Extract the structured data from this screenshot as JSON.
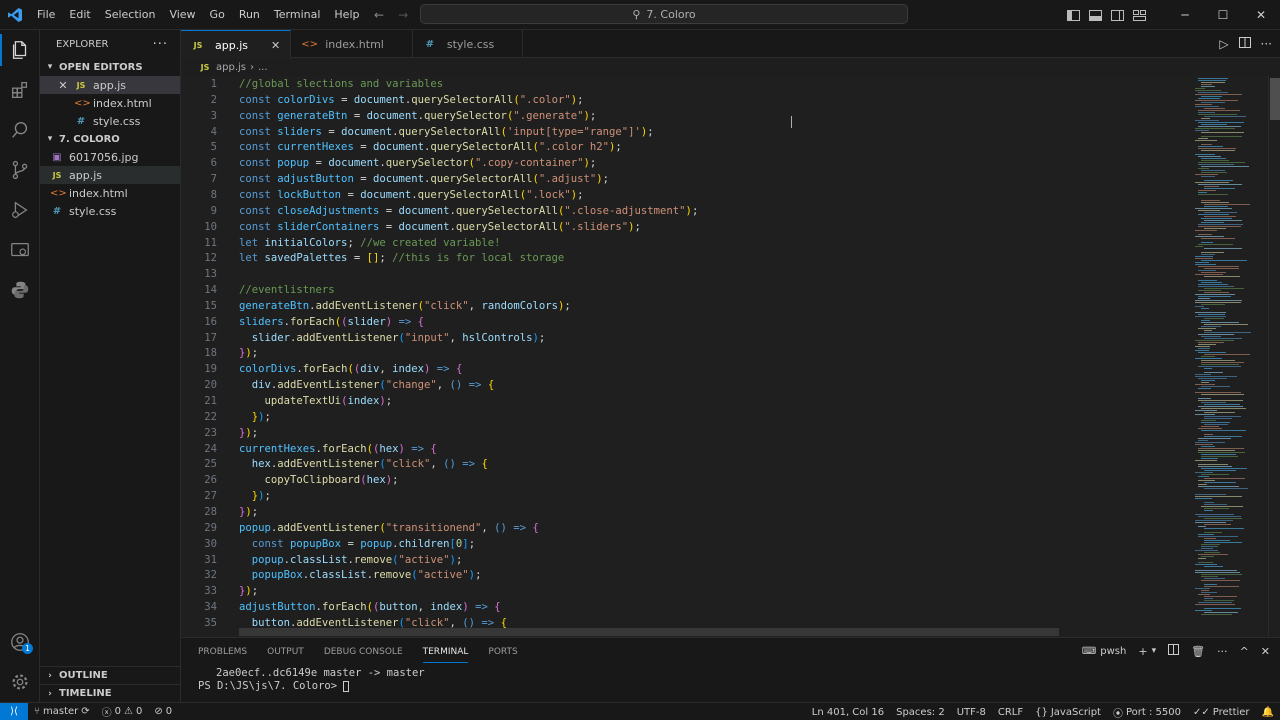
{
  "menu": [
    "File",
    "Edit",
    "Selection",
    "View",
    "Go",
    "Run",
    "Terminal",
    "Help"
  ],
  "command_center": "7. Coloro",
  "explorer": {
    "title": "EXPLORER",
    "open_editors_label": "OPEN EDITORS",
    "open_editors": [
      {
        "name": "app.js",
        "type": "js"
      },
      {
        "name": "index.html",
        "type": "html"
      },
      {
        "name": "style.css",
        "type": "css"
      }
    ],
    "folder_label": "7. COLORO",
    "files": [
      {
        "name": "6017056.jpg",
        "type": "img"
      },
      {
        "name": "app.js",
        "type": "js"
      },
      {
        "name": "index.html",
        "type": "html"
      },
      {
        "name": "style.css",
        "type": "css"
      }
    ],
    "outline_label": "OUTLINE",
    "timeline_label": "TIMELINE"
  },
  "tabs": [
    {
      "name": "app.js",
      "type": "js"
    },
    {
      "name": "index.html",
      "type": "html"
    },
    {
      "name": "style.css",
      "type": "css"
    }
  ],
  "breadcrumb": {
    "file": "app.js",
    "more": "..."
  },
  "code_lines": [
    [
      [
        "//global slections and variables",
        "cm"
      ]
    ],
    [
      [
        "const ",
        "kw"
      ],
      [
        "colorDivs",
        "var"
      ],
      [
        " = ",
        "p"
      ],
      [
        "document",
        "id"
      ],
      [
        ".",
        "p"
      ],
      [
        "querySelectorAll",
        "fn"
      ],
      [
        "(",
        "br"
      ],
      [
        "\".color\"",
        "str"
      ],
      [
        ")",
        "br"
      ],
      [
        ";",
        "p"
      ]
    ],
    [
      [
        "const ",
        "kw"
      ],
      [
        "generateBtn",
        "var"
      ],
      [
        " = ",
        "p"
      ],
      [
        "document",
        "id"
      ],
      [
        ".",
        "p"
      ],
      [
        "querySelector",
        "fn"
      ],
      [
        "(",
        "br"
      ],
      [
        "\".generate\"",
        "str"
      ],
      [
        ")",
        "br"
      ],
      [
        ";",
        "p"
      ]
    ],
    [
      [
        "const ",
        "kw"
      ],
      [
        "sliders",
        "var"
      ],
      [
        " = ",
        "p"
      ],
      [
        "document",
        "id"
      ],
      [
        ".",
        "p"
      ],
      [
        "querySelectorAll",
        "fn"
      ],
      [
        "(",
        "br"
      ],
      [
        "'input[type=\"range\"]'",
        "str"
      ],
      [
        ")",
        "br"
      ],
      [
        ";",
        "p"
      ]
    ],
    [
      [
        "const ",
        "kw"
      ],
      [
        "currentHexes",
        "var"
      ],
      [
        " = ",
        "p"
      ],
      [
        "document",
        "id"
      ],
      [
        ".",
        "p"
      ],
      [
        "querySelectorAll",
        "fn"
      ],
      [
        "(",
        "br"
      ],
      [
        "\".color h2\"",
        "str"
      ],
      [
        ")",
        "br"
      ],
      [
        ";",
        "p"
      ]
    ],
    [
      [
        "const ",
        "kw"
      ],
      [
        "popup",
        "var"
      ],
      [
        " = ",
        "p"
      ],
      [
        "document",
        "id"
      ],
      [
        ".",
        "p"
      ],
      [
        "querySelector",
        "fn"
      ],
      [
        "(",
        "br"
      ],
      [
        "\".copy-container\"",
        "str"
      ],
      [
        ")",
        "br"
      ],
      [
        ";",
        "p"
      ]
    ],
    [
      [
        "const ",
        "kw"
      ],
      [
        "adjustButton",
        "var"
      ],
      [
        " = ",
        "p"
      ],
      [
        "document",
        "id"
      ],
      [
        ".",
        "p"
      ],
      [
        "querySelectorAll",
        "fn"
      ],
      [
        "(",
        "br"
      ],
      [
        "\".adjust\"",
        "str"
      ],
      [
        ")",
        "br"
      ],
      [
        ";",
        "p"
      ]
    ],
    [
      [
        "const ",
        "kw"
      ],
      [
        "lockButton",
        "var"
      ],
      [
        " = ",
        "p"
      ],
      [
        "document",
        "id"
      ],
      [
        ".",
        "p"
      ],
      [
        "querySelectorAll",
        "fn"
      ],
      [
        "(",
        "br"
      ],
      [
        "\".lock\"",
        "str"
      ],
      [
        ")",
        "br"
      ],
      [
        ";",
        "p"
      ]
    ],
    [
      [
        "const ",
        "kw"
      ],
      [
        "closeAdjustments",
        "var"
      ],
      [
        " = ",
        "p"
      ],
      [
        "document",
        "id"
      ],
      [
        ".",
        "p"
      ],
      [
        "querySelectorAll",
        "fn"
      ],
      [
        "(",
        "br"
      ],
      [
        "\".close-adjustment\"",
        "str"
      ],
      [
        ")",
        "br"
      ],
      [
        ";",
        "p"
      ]
    ],
    [
      [
        "const ",
        "kw"
      ],
      [
        "sliderContainers",
        "var"
      ],
      [
        " = ",
        "p"
      ],
      [
        "document",
        "id"
      ],
      [
        ".",
        "p"
      ],
      [
        "querySelectorAll",
        "fn"
      ],
      [
        "(",
        "br"
      ],
      [
        "\".sliders\"",
        "str"
      ],
      [
        ")",
        "br"
      ],
      [
        ";",
        "p"
      ]
    ],
    [
      [
        "let ",
        "kw"
      ],
      [
        "initialColors",
        "id"
      ],
      [
        "; ",
        "p"
      ],
      [
        "//we created variable!",
        "cm"
      ]
    ],
    [
      [
        "let ",
        "kw"
      ],
      [
        "savedPalettes",
        "id"
      ],
      [
        " = ",
        "p"
      ],
      [
        "[]",
        "br"
      ],
      [
        "; ",
        "p"
      ],
      [
        "//this is for local storage",
        "cm"
      ]
    ],
    [],
    [
      [
        "//eventlistners",
        "cm"
      ]
    ],
    [
      [
        "generateBtn",
        "var"
      ],
      [
        ".",
        "p"
      ],
      [
        "addEventListener",
        "fn"
      ],
      [
        "(",
        "br"
      ],
      [
        "\"click\"",
        "str"
      ],
      [
        ", ",
        "p"
      ],
      [
        "randomColors",
        "id"
      ],
      [
        ")",
        "br"
      ],
      [
        ";",
        "p"
      ]
    ],
    [
      [
        "sliders",
        "var"
      ],
      [
        ".",
        "p"
      ],
      [
        "forEach",
        "fn"
      ],
      [
        "(",
        "br"
      ],
      [
        "(",
        "br2"
      ],
      [
        "slider",
        "id"
      ],
      [
        ")",
        "br2"
      ],
      [
        " => ",
        "kw"
      ],
      [
        "{",
        "br2"
      ]
    ],
    [
      [
        "  slider",
        "id"
      ],
      [
        ".",
        "p"
      ],
      [
        "addEventListener",
        "fn"
      ],
      [
        "(",
        "br3"
      ],
      [
        "\"input\"",
        "str"
      ],
      [
        ", ",
        "p"
      ],
      [
        "hslControls",
        "id"
      ],
      [
        ")",
        "br3"
      ],
      [
        ";",
        "p"
      ]
    ],
    [
      [
        "}",
        "br2"
      ],
      [
        ")",
        "br"
      ],
      [
        ";",
        "p"
      ]
    ],
    [
      [
        "colorDivs",
        "var"
      ],
      [
        ".",
        "p"
      ],
      [
        "forEach",
        "fn"
      ],
      [
        "(",
        "br"
      ],
      [
        "(",
        "br2"
      ],
      [
        "div",
        "id"
      ],
      [
        ", ",
        "p"
      ],
      [
        "index",
        "id"
      ],
      [
        ")",
        "br2"
      ],
      [
        " => ",
        "kw"
      ],
      [
        "{",
        "br2"
      ]
    ],
    [
      [
        "  div",
        "id"
      ],
      [
        ".",
        "p"
      ],
      [
        "addEventListener",
        "fn"
      ],
      [
        "(",
        "br3"
      ],
      [
        "\"change\"",
        "str"
      ],
      [
        ", ",
        "p"
      ],
      [
        "() => ",
        "kw"
      ],
      [
        "{",
        "br"
      ]
    ],
    [
      [
        "    updateTextUi",
        "fn"
      ],
      [
        "(",
        "br2"
      ],
      [
        "index",
        "id"
      ],
      [
        ")",
        "br2"
      ],
      [
        ";",
        "p"
      ]
    ],
    [
      [
        "  }",
        "br"
      ],
      [
        ")",
        "br3"
      ],
      [
        ";",
        "p"
      ]
    ],
    [
      [
        "}",
        "br2"
      ],
      [
        ")",
        "br"
      ],
      [
        ";",
        "p"
      ]
    ],
    [
      [
        "currentHexes",
        "var"
      ],
      [
        ".",
        "p"
      ],
      [
        "forEach",
        "fn"
      ],
      [
        "(",
        "br"
      ],
      [
        "(",
        "br2"
      ],
      [
        "hex",
        "id"
      ],
      [
        ")",
        "br2"
      ],
      [
        " => ",
        "kw"
      ],
      [
        "{",
        "br2"
      ]
    ],
    [
      [
        "  hex",
        "id"
      ],
      [
        ".",
        "p"
      ],
      [
        "addEventListener",
        "fn"
      ],
      [
        "(",
        "br3"
      ],
      [
        "\"click\"",
        "str"
      ],
      [
        ", ",
        "p"
      ],
      [
        "() => ",
        "kw"
      ],
      [
        "{",
        "br"
      ]
    ],
    [
      [
        "    copyToClipboard",
        "fn"
      ],
      [
        "(",
        "br2"
      ],
      [
        "hex",
        "id"
      ],
      [
        ")",
        "br2"
      ],
      [
        ";",
        "p"
      ]
    ],
    [
      [
        "  }",
        "br"
      ],
      [
        ")",
        "br3"
      ],
      [
        ";",
        "p"
      ]
    ],
    [
      [
        "}",
        "br2"
      ],
      [
        ")",
        "br"
      ],
      [
        ";",
        "p"
      ]
    ],
    [
      [
        "popup",
        "var"
      ],
      [
        ".",
        "p"
      ],
      [
        "addEventListener",
        "fn"
      ],
      [
        "(",
        "br"
      ],
      [
        "\"transitionend\"",
        "str"
      ],
      [
        ", ",
        "p"
      ],
      [
        "() => ",
        "kw"
      ],
      [
        "{",
        "br2"
      ]
    ],
    [
      [
        "  const ",
        "kw"
      ],
      [
        "popupBox",
        "var"
      ],
      [
        " = ",
        "p"
      ],
      [
        "popup",
        "var"
      ],
      [
        ".",
        "p"
      ],
      [
        "children",
        "id"
      ],
      [
        "[",
        "br3"
      ],
      [
        "0",
        "num"
      ],
      [
        "]",
        "br3"
      ],
      [
        ";",
        "p"
      ]
    ],
    [
      [
        "  popup",
        "var"
      ],
      [
        ".",
        "p"
      ],
      [
        "classList",
        "id"
      ],
      [
        ".",
        "p"
      ],
      [
        "remove",
        "fn"
      ],
      [
        "(",
        "br3"
      ],
      [
        "\"active\"",
        "str"
      ],
      [
        ")",
        "br3"
      ],
      [
        ";",
        "p"
      ]
    ],
    [
      [
        "  popupBox",
        "var"
      ],
      [
        ".",
        "p"
      ],
      [
        "classList",
        "id"
      ],
      [
        ".",
        "p"
      ],
      [
        "remove",
        "fn"
      ],
      [
        "(",
        "br3"
      ],
      [
        "\"active\"",
        "str"
      ],
      [
        ")",
        "br3"
      ],
      [
        ";",
        "p"
      ]
    ],
    [
      [
        "}",
        "br2"
      ],
      [
        ")",
        "br"
      ],
      [
        ";",
        "p"
      ]
    ],
    [
      [
        "adjustButton",
        "var"
      ],
      [
        ".",
        "p"
      ],
      [
        "forEach",
        "fn"
      ],
      [
        "(",
        "br"
      ],
      [
        "(",
        "br2"
      ],
      [
        "button",
        "id"
      ],
      [
        ", ",
        "p"
      ],
      [
        "index",
        "id"
      ],
      [
        ")",
        "br2"
      ],
      [
        " => ",
        "kw"
      ],
      [
        "{",
        "br2"
      ]
    ],
    [
      [
        "  button",
        "id"
      ],
      [
        ".",
        "p"
      ],
      [
        "addEventListener",
        "fn"
      ],
      [
        "(",
        "br3"
      ],
      [
        "\"click\"",
        "str"
      ],
      [
        ", ",
        "p"
      ],
      [
        "() => ",
        "kw"
      ],
      [
        "{",
        "br"
      ]
    ]
  ],
  "panel": {
    "tabs": [
      "PROBLEMS",
      "OUTPUT",
      "DEBUG CONSOLE",
      "TERMINAL",
      "PORTS"
    ],
    "active_tab": "TERMINAL",
    "shell": "pwsh",
    "terminal_line1": "2ae0ecf..dc6149e  master -> master",
    "terminal_prompt": "PS D:\\JS\\js\\7. Coloro> "
  },
  "status": {
    "branch": "master",
    "errors": "0",
    "warnings": "0",
    "ports_forwarded": "0",
    "position": "Ln 401, Col 16",
    "spaces": "Spaces: 2",
    "encoding": "UTF-8",
    "eol": "CRLF",
    "language": "JavaScript",
    "port": "Port : 5500",
    "prettier": "Prettier"
  },
  "colors": {
    "accent": "#0078d4",
    "editor_bg": "#1f1f1f",
    "chrome_bg": "#181818"
  },
  "icons": [
    "explorer-icon",
    "search-icon",
    "source-control-icon",
    "run-debug-icon",
    "remote-explorer-icon",
    "python-icon",
    "account-icon",
    "manage-icon"
  ]
}
